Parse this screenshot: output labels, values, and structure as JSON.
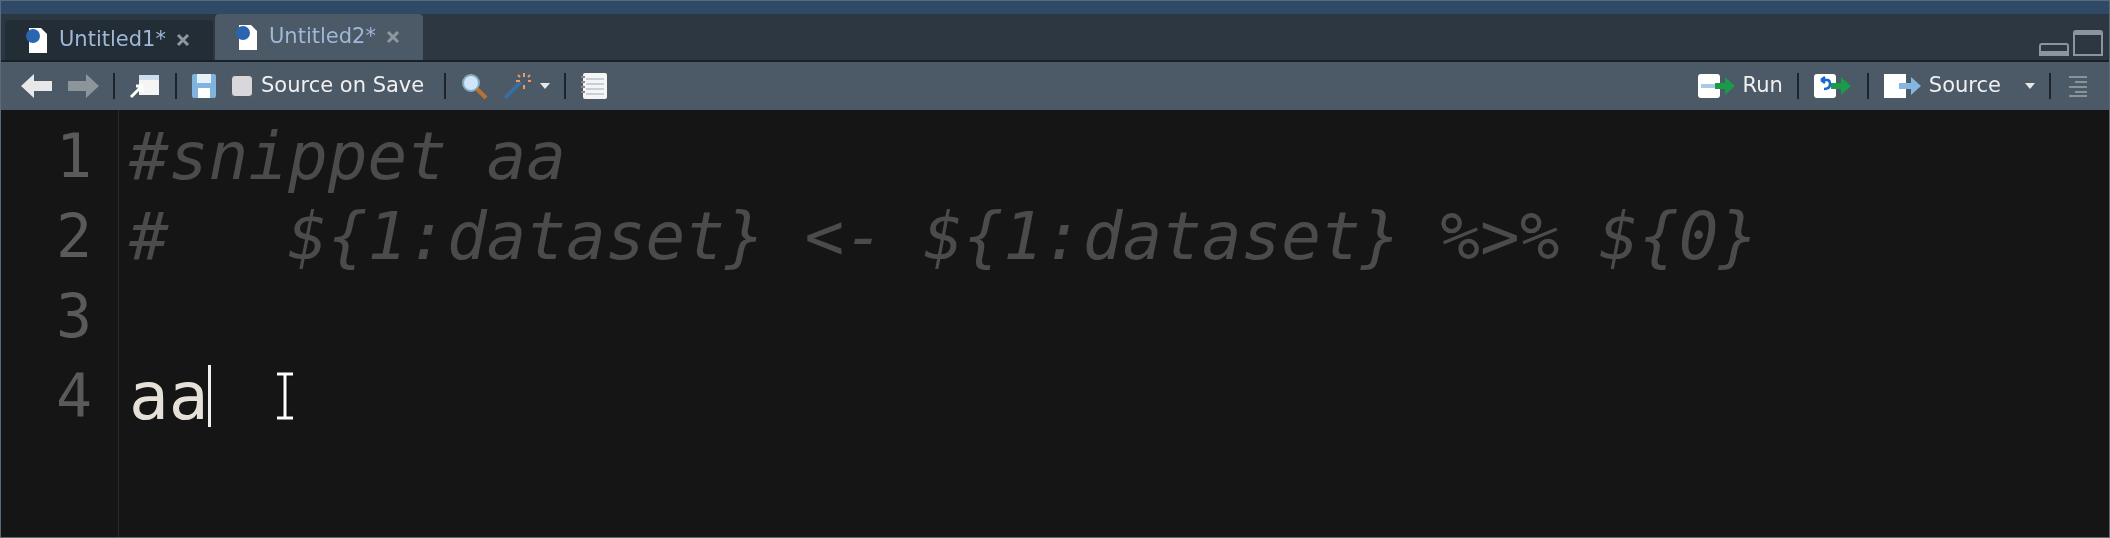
{
  "tabs": [
    {
      "label": "Untitled1*",
      "selected": false
    },
    {
      "label": "Untitled2*",
      "selected": true
    }
  ],
  "toolbar": {
    "source_on_save": {
      "label": "Source on Save",
      "checked": false
    },
    "run": "Run",
    "source": "Source"
  },
  "editor": {
    "lines": [
      {
        "number": "1",
        "kind": "comment",
        "text": "#snippet aa"
      },
      {
        "number": "2",
        "kind": "comment",
        "text": "#   ${1:dataset} <- ${1:dataset} %>% ${0}"
      },
      {
        "number": "3"
      },
      {
        "number": "4",
        "kind": "code",
        "text": "aa",
        "caret": true
      }
    ]
  }
}
